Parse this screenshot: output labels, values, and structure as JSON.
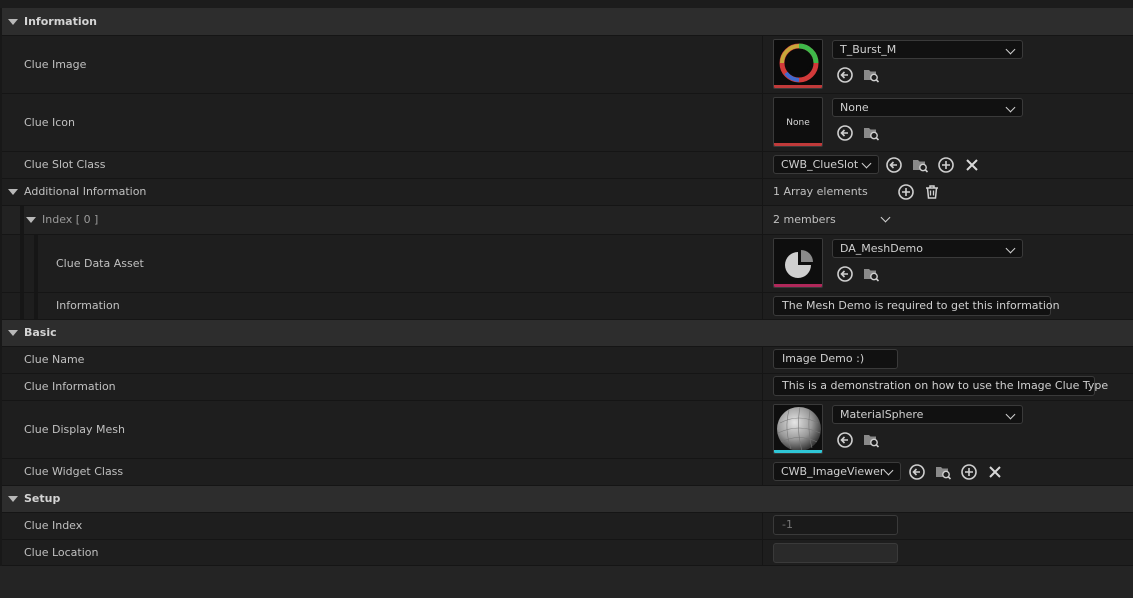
{
  "sections": {
    "information": "Information",
    "basic": "Basic",
    "setup": "Setup"
  },
  "information": {
    "clue_image": {
      "label": "Clue Image",
      "value": "T_Burst_M"
    },
    "clue_icon": {
      "label": "Clue Icon",
      "value": "None",
      "thumb_text": "None"
    },
    "clue_slot_class": {
      "label": "Clue Slot Class",
      "value": "CWB_ClueSlot"
    },
    "additional_information": {
      "label": "Additional Information",
      "count_text": "1 Array elements",
      "index": {
        "label": "Index [ 0 ]",
        "members_text": "2 members",
        "clue_data_asset": {
          "label": "Clue Data Asset",
          "value": "DA_MeshDemo"
        },
        "information": {
          "label": "Information",
          "value": "The Mesh Demo is required to get this information"
        }
      }
    }
  },
  "basic": {
    "clue_name": {
      "label": "Clue Name",
      "value": "Image Demo :)"
    },
    "clue_information": {
      "label": "Clue Information",
      "value": "This is a demonstration on how to use the Image Clue Type"
    },
    "clue_display_mesh": {
      "label": "Clue Display Mesh",
      "value": "MaterialSphere"
    },
    "clue_widget_class": {
      "label": "Clue Widget Class",
      "value": "CWB_ImageViewer"
    }
  },
  "setup": {
    "clue_index": {
      "label": "Clue Index",
      "value": "-1"
    },
    "clue_location": {
      "label": "Clue Location",
      "value": ""
    }
  },
  "icons": [
    "expand-arrow-icon",
    "use-selected-icon",
    "browse-icon",
    "add-icon",
    "clear-icon",
    "delete-icon",
    "chevron-down-icon"
  ],
  "colors": {
    "texture_bar": "#c03a3a",
    "data_asset_bar": "#b0285a",
    "mesh_bar": "#2fc6d6",
    "background": "#1e1e1e",
    "category": "#2d2d2d"
  }
}
